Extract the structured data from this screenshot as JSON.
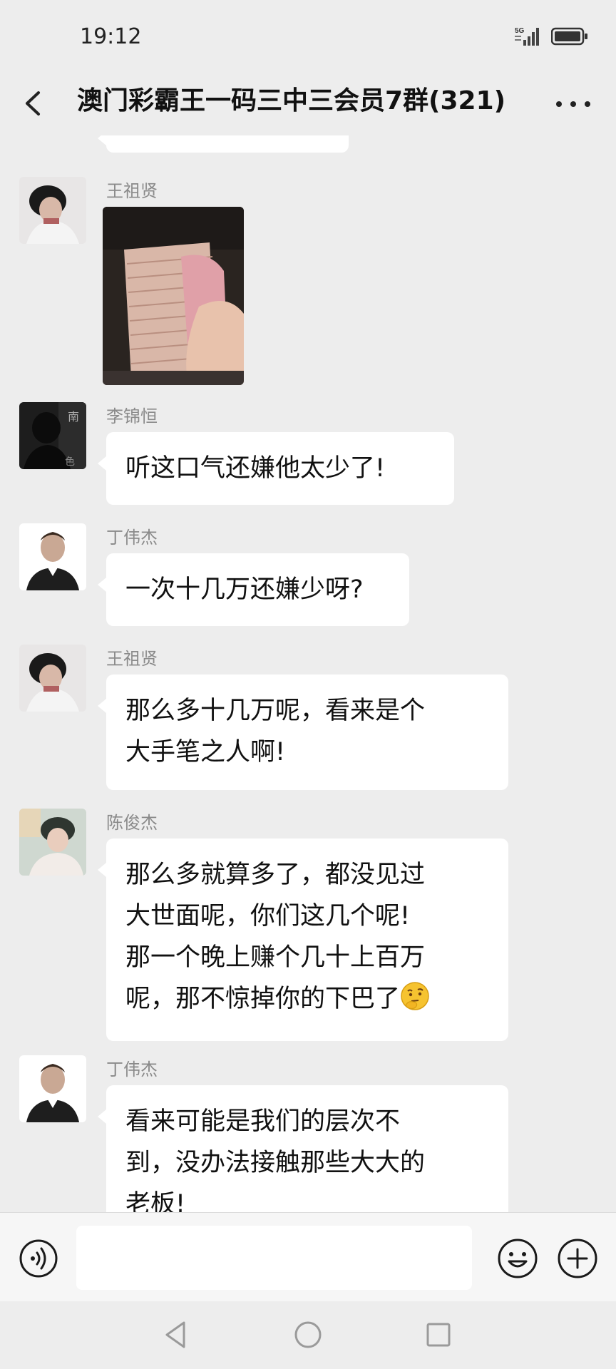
{
  "status_bar": {
    "time": "19:12",
    "network": "5G"
  },
  "header": {
    "title": "澳门彩霸王一码三中三会员7群(321)"
  },
  "messages": [
    {
      "sender": "王祖贤",
      "type": "image",
      "image_desc": "hand-holding-cash-photo"
    },
    {
      "sender": "李锦恒",
      "type": "text",
      "lines": [
        "听这口气还嫌他太少了!"
      ]
    },
    {
      "sender": "丁伟杰",
      "type": "text",
      "lines": [
        "一次十几万还嫌少呀?"
      ]
    },
    {
      "sender": "王祖贤",
      "type": "text",
      "lines": [
        "那么多十几万呢，看来是个",
        "大手笔之人啊!"
      ]
    },
    {
      "sender": "陈俊杰",
      "type": "text",
      "lines": [
        "那么多就算多了，都没见过",
        "大世面呢，你们这几个呢!",
        "那一个晚上赚个几十上百万",
        "呢，那不惊掉你的下巴了"
      ],
      "emoji": "thinking-face-emoji"
    },
    {
      "sender": "丁伟杰",
      "type": "text",
      "lines": [
        "看来可能是我们的层次不",
        "到，没办法接触那些大大的",
        "老板!"
      ]
    }
  ],
  "input_bar": {
    "value": "",
    "placeholder": ""
  },
  "colors": {
    "background": "#ededed",
    "bubble": "#ffffff",
    "sender_name": "#8a8a8a",
    "emoji_yellow": "#f6c330"
  }
}
